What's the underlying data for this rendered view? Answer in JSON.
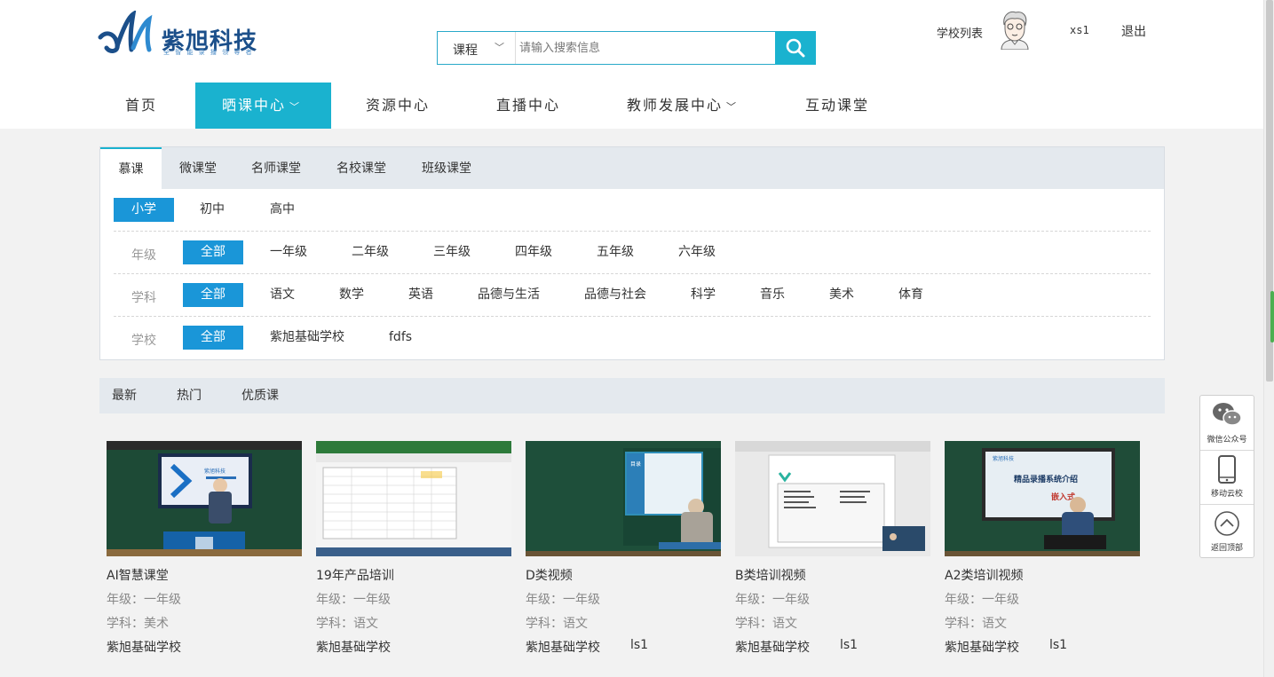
{
  "brand": {
    "name": "紫旭科技",
    "tagline": "全 智 能 录 播 领 导 者",
    "color": "#1b4f8a"
  },
  "search": {
    "type_selected": "课程",
    "placeholder": "请输入搜索信息"
  },
  "user": {
    "school_list": "学校列表",
    "username": "xs1",
    "logout": "退出"
  },
  "nav": {
    "items": [
      {
        "label": "首页",
        "active": false,
        "dropdown": false
      },
      {
        "label": "晒课中心",
        "active": true,
        "dropdown": true
      },
      {
        "label": "资源中心",
        "active": false,
        "dropdown": false
      },
      {
        "label": "直播中心",
        "active": false,
        "dropdown": false
      },
      {
        "label": "教师发展中心",
        "active": false,
        "dropdown": true
      },
      {
        "label": "互动课堂",
        "active": false,
        "dropdown": false
      }
    ],
    "dropdown_glyph": "﹀"
  },
  "tabs": [
    "慕课",
    "微课堂",
    "名师课堂",
    "名校课堂",
    "班级课堂"
  ],
  "filters": {
    "stage": [
      "小学",
      "初中",
      "高中"
    ],
    "grade": {
      "label": "年级",
      "options": [
        "全部",
        "一年级",
        "二年级",
        "三年级",
        "四年级",
        "五年级",
        "六年级"
      ]
    },
    "subject": {
      "label": "学科",
      "options": [
        "全部",
        "语文",
        "数学",
        "英语",
        "品德与生活",
        "品德与社会",
        "科学",
        "音乐",
        "美术",
        "体育"
      ]
    },
    "school": {
      "label": "学校",
      "options": [
        "全部",
        "紫旭基础学校",
        "fdfs"
      ]
    }
  },
  "sort": [
    "最新",
    "热门",
    "优质课"
  ],
  "courses": [
    {
      "title": "AI智慧课堂",
      "grade": "年级：一年级",
      "subject": "学科：美术",
      "school": "紫旭基础学校",
      "teacher": ""
    },
    {
      "title": "19年产品培训",
      "grade": "年级：一年级",
      "subject": "学科：语文",
      "school": "紫旭基础学校",
      "teacher": ""
    },
    {
      "title": "D类视频",
      "grade": "年级：一年级",
      "subject": "学科：语文",
      "school": "紫旭基础学校",
      "teacher": "ls1"
    },
    {
      "title": "B类培训视频",
      "grade": "年级：一年级",
      "subject": "学科：语文",
      "school": "紫旭基础学校",
      "teacher": "ls1"
    },
    {
      "title": "A2类培训视频",
      "grade": "年级：一年级",
      "subject": "学科：语文",
      "school": "紫旭基础学校",
      "teacher": "ls1"
    }
  ],
  "thumb_texts": {
    "screen_brand": "紫旭科技",
    "screen_word": "目录",
    "screen_title": "精品录播系统介绍",
    "screen_sub": "嵌入式"
  },
  "side": {
    "wechat": "微信公众号",
    "mobile": "移动云校",
    "top": "返回顶部"
  },
  "colors": {
    "accent": "#1ab2cf",
    "selected": "#1a96d8"
  }
}
